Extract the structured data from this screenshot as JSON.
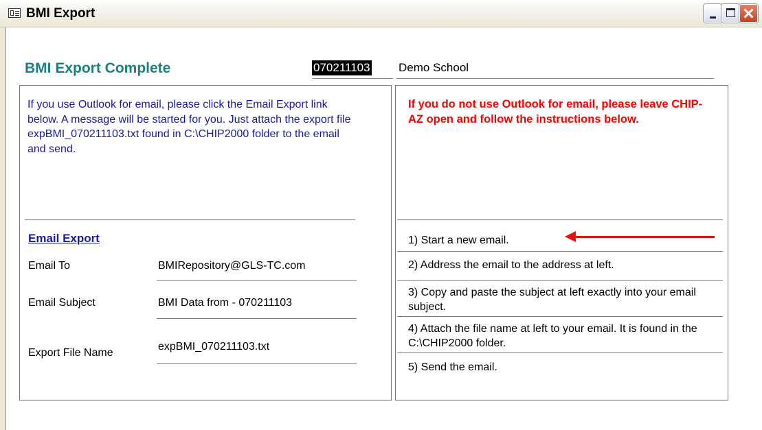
{
  "window": {
    "title": "BMI Export",
    "icon": "form-icon"
  },
  "header": {
    "title": "BMI Export Complete",
    "school_code": "070211103",
    "school_name": "Demo School"
  },
  "left": {
    "intro": "If you use Outlook for email, please click the Email Export link below. A message will be started for you. Just attach the export file expBMI_070211103.txt found in C:\\CHIP2000 folder to the email and send.",
    "link_label": "Email Export",
    "fields": [
      {
        "label": "Email To",
        "value": "BMIRepository@GLS-TC.com"
      },
      {
        "label": "Email Subject",
        "value": "BMI Data from - 070211103"
      },
      {
        "label": "Export File Name",
        "value": "expBMI_070211103.txt"
      }
    ]
  },
  "right": {
    "warning": "If you do not use Outlook for email, please leave CHIP-AZ open and follow the instructions below.",
    "steps": [
      "1) Start a new email.",
      "2) Address the email to the address at left.",
      "3) Copy and paste the subject at left exactly into your email subject.",
      "4) Attach the file name at left to your email. It is found in the C:\\CHIP2000 folder.",
      "5) Send the email."
    ]
  },
  "colors": {
    "heading": "#1b8080",
    "link": "#1a1aa0",
    "warning": "#ff0000",
    "arrow": "#e41212"
  }
}
